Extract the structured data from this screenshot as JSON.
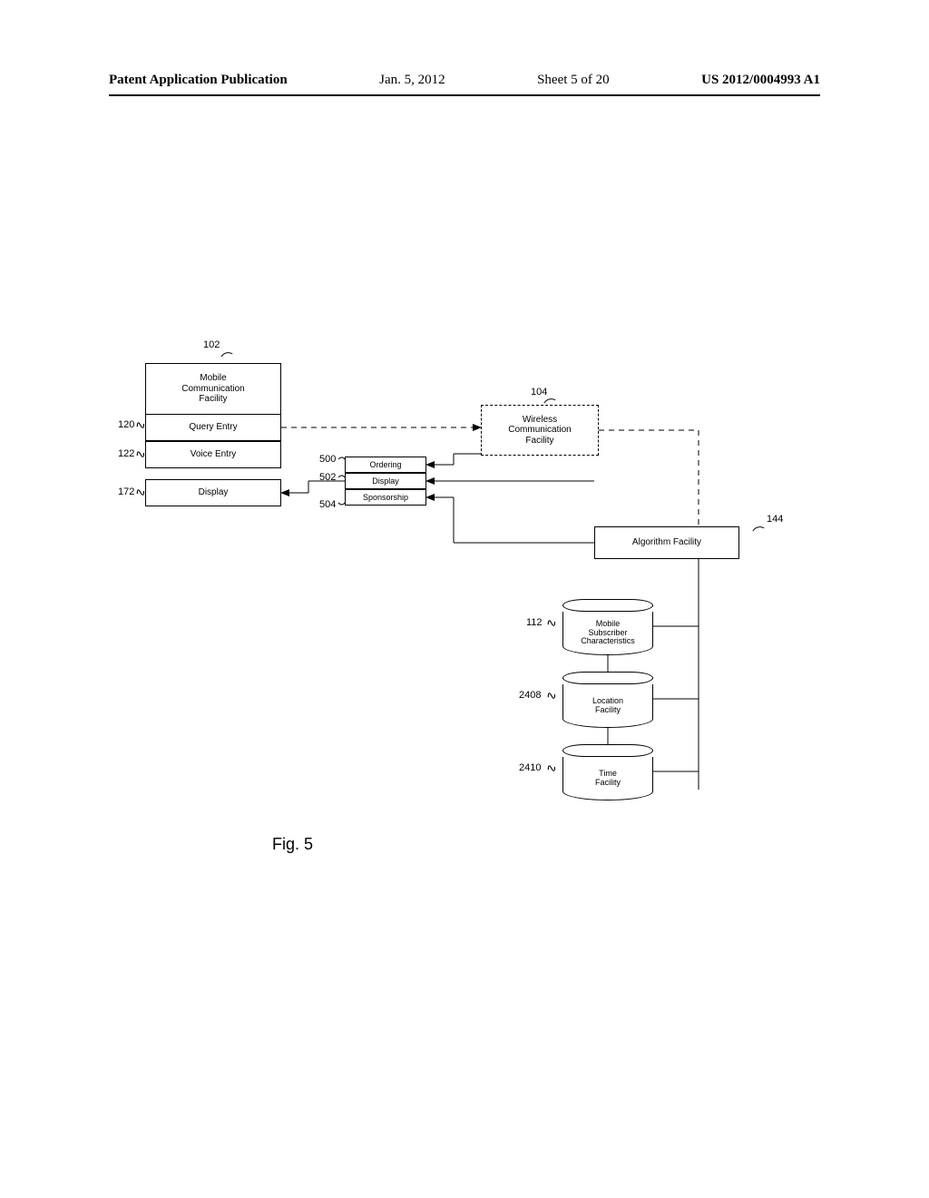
{
  "header": {
    "pubtype": "Patent Application Publication",
    "date": "Jan. 5, 2012",
    "sheet": "Sheet 5 of 20",
    "pubno": "US 2012/0004993 A1"
  },
  "figure_caption": "Fig. 5",
  "refs": {
    "mobile_facility": "102",
    "wireless_facility": "104",
    "query_entry": "120",
    "voice_entry": "122",
    "display_row": "172",
    "ordering": "500",
    "display_small": "502",
    "sponsorship": "504",
    "algorithm_facility": "144",
    "mobile_sub": "112",
    "location_facility": "2408",
    "time_facility": "2410"
  },
  "boxes": {
    "mobile_facility": "Mobile\nCommunication\nFacility",
    "query_entry": "Query Entry",
    "voice_entry": "Voice Entry",
    "display_row": "Display",
    "ordering": "Ordering",
    "display_small": "Display",
    "sponsorship": "Sponsorship",
    "wireless_facility": "Wireless\nCommunication\nFacility",
    "algorithm_facility": "Algorithm Facility",
    "mobile_sub": "Mobile\nSubscriber\nCharacteristics",
    "location_facility": "Location\nFacility",
    "time_facility": "Time\nFacility"
  },
  "chart_data": {
    "type": "diagram",
    "title": "Fig. 5",
    "nodes": [
      {
        "id": "102",
        "label": "Mobile Communication Facility",
        "kind": "container",
        "style": "solid"
      },
      {
        "id": "120",
        "label": "Query Entry",
        "kind": "row",
        "parent": "102"
      },
      {
        "id": "122",
        "label": "Voice Entry",
        "kind": "row",
        "parent": "102"
      },
      {
        "id": "172",
        "label": "Display",
        "kind": "row",
        "parent": "102"
      },
      {
        "id": "104",
        "label": "Wireless Communication Facility",
        "kind": "box",
        "style": "dashed"
      },
      {
        "id": "500",
        "label": "Ordering",
        "kind": "smallbox"
      },
      {
        "id": "502",
        "label": "Display",
        "kind": "smallbox"
      },
      {
        "id": "504",
        "label": "Sponsorship",
        "kind": "smallbox"
      },
      {
        "id": "144",
        "label": "Algorithm Facility",
        "kind": "box"
      },
      {
        "id": "112",
        "label": "Mobile Subscriber Characteristics",
        "kind": "cylinder"
      },
      {
        "id": "2408",
        "label": "Location Facility",
        "kind": "cylinder"
      },
      {
        "id": "2410",
        "label": "Time Facility",
        "kind": "cylinder"
      }
    ],
    "edges": [
      {
        "from": "120",
        "to": "104",
        "style": "dashed",
        "arrow": "to"
      },
      {
        "from": "104",
        "to": "500-502-504-group",
        "style": "solid",
        "arrow": "to",
        "note": "into ordering/display/sponsorship block"
      },
      {
        "from": "500-502-504-group",
        "to": "172",
        "style": "solid",
        "arrow": "to"
      },
      {
        "from": "104",
        "to": "144",
        "style": "dashed",
        "arrow": "none",
        "via": "right-side"
      },
      {
        "from": "144",
        "to": "500-502-504-group",
        "style": "solid",
        "arrow": "to"
      },
      {
        "from": "144",
        "to": "112",
        "style": "solid",
        "arrow": "none"
      },
      {
        "from": "144",
        "to": "2408",
        "style": "solid",
        "arrow": "none"
      },
      {
        "from": "144",
        "to": "2410",
        "style": "solid",
        "arrow": "none"
      },
      {
        "from": "112",
        "to": "2408",
        "style": "solid",
        "arrow": "none"
      },
      {
        "from": "2408",
        "to": "2410",
        "style": "solid",
        "arrow": "none"
      }
    ]
  }
}
